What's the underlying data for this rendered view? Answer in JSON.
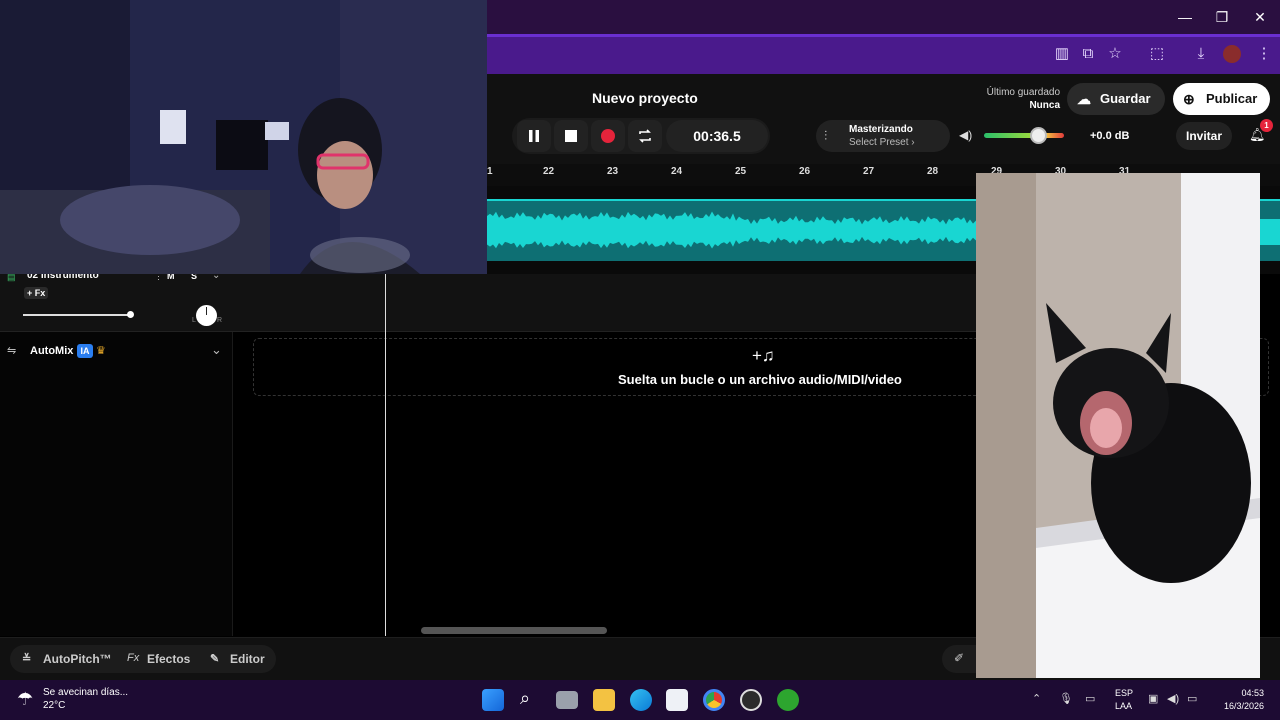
{
  "browser": {
    "window_controls": {
      "minimize": "—",
      "maximize": "❐",
      "close": "✕"
    }
  },
  "app": {
    "project_title": "Nuevo proyecto",
    "time": "00:36.5",
    "mastering": {
      "title": "Masterizando",
      "preset": "Select Preset ›"
    },
    "volume_db": "+0.0 dB",
    "volume_level": 0.68,
    "last_saved_label": "Último guardado",
    "last_saved_value": "Nunca",
    "save_label": "Guardar",
    "publish_label": "Publicar",
    "invite_label": "Invitar",
    "notifications_count": "1",
    "accent": "#19d6d2"
  },
  "timeline": {
    "ruler": [
      "1",
      "22",
      "23",
      "24",
      "25",
      "26",
      "27",
      "28",
      "29",
      "30",
      "31"
    ]
  },
  "track2": {
    "name": "02 Instrumento",
    "fx": "+ Fx",
    "mute": "M",
    "solo": "S",
    "pan_left": "L",
    "pan_right": "R"
  },
  "automix": {
    "label": "AutoMix",
    "badge": "IA"
  },
  "drop_zone": {
    "text": "Suelta un bucle o un archivo audio/MIDI/video"
  },
  "bottom_toolbar": {
    "autopitch": "AutoPitch™",
    "effects_prefix": "Fx",
    "effects": "Efectos",
    "editor": "Editor"
  },
  "taskbar": {
    "weather_title": "Se avecinan días...",
    "weather_temp": "22°C",
    "lang_top": "ESP",
    "lang_bottom": "LAA",
    "time": "04:53",
    "date": "16/3/2026"
  }
}
